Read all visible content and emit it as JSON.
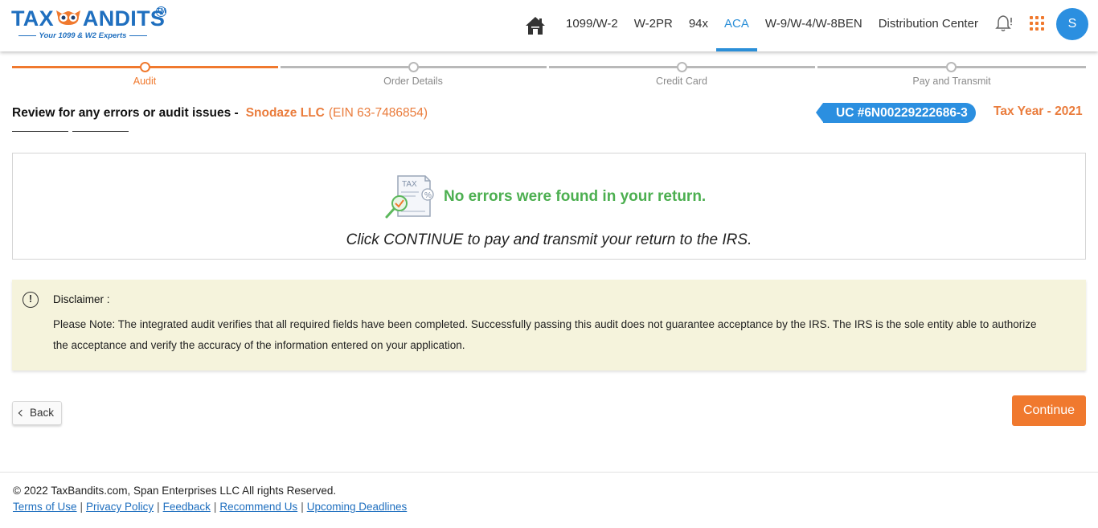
{
  "header": {
    "logo_text_left": "TAX",
    "logo_text_right": "ANDITS",
    "logo_tagline": "Your 1099 & W2 Experts",
    "logo_tm": "TM",
    "nav": [
      {
        "label": "1099/W-2",
        "active": false
      },
      {
        "label": "W-2PR",
        "active": false
      },
      {
        "label": "94x",
        "active": false
      },
      {
        "label": "ACA",
        "active": true
      },
      {
        "label": "W-9/W-4/W-8BEN",
        "active": false
      },
      {
        "label": "Distribution Center",
        "active": false
      }
    ],
    "avatar_initial": "S",
    "icons": {
      "home": "home-icon",
      "bell": "bell-icon",
      "apps": "apps-grid-icon"
    }
  },
  "stepper": {
    "steps": [
      {
        "label": "Audit",
        "status": "current"
      },
      {
        "label": "Order Details",
        "status": "pending"
      },
      {
        "label": "Credit Card",
        "status": "pending"
      },
      {
        "label": "Pay and Transmit",
        "status": "pending"
      }
    ]
  },
  "review": {
    "title": "Review for any errors or audit issues -",
    "company": "Snodaze LLC",
    "ein": "(EIN 63-7486854)",
    "uc_number": "UC #6N00229222686-3",
    "tax_year": "Tax Year - 2021"
  },
  "result": {
    "headline": "No errors were found in your return.",
    "message": "Click CONTINUE to pay and transmit your return to the IRS."
  },
  "disclaimer": {
    "title": "Disclaimer :",
    "text": "Please Note: The integrated audit verifies that all required fields have been completed. Successfully passing this audit does not guarantee acceptance by the IRS. The IRS is the sole entity able to authorize the acceptance and verify the accuracy of the information entered on your application."
  },
  "actions": {
    "back_label": "Back",
    "continue_label": "Continue"
  },
  "footer": {
    "copyright": "© 2022 TaxBandits.com, Span Enterprises LLC All rights Reserved.",
    "links": [
      "Terms of Use",
      "Privacy Policy",
      "Feedback",
      "Recommend Us",
      "Upcoming Deadlines"
    ]
  },
  "colors": {
    "brand_blue": "#1f6fbf",
    "accent_orange": "#f0792e",
    "active_blue": "#2b8fd8",
    "success_green": "#4caf50",
    "disclaimer_bg": "#f5f3dc"
  }
}
